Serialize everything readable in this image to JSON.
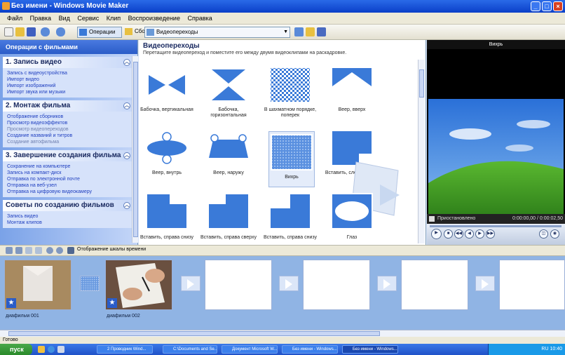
{
  "window": {
    "title": "Без имени - Windows Movie Maker",
    "minimize": "_",
    "maximize": "□",
    "close": "×"
  },
  "menu": {
    "items": [
      "Файл",
      "Правка",
      "Вид",
      "Сервис",
      "Клип",
      "Воспроизведение",
      "Справка"
    ]
  },
  "toolbar": {
    "tasks_label": "Операции",
    "collections_label": "Сборники",
    "collection_value": "Видеопереходы"
  },
  "tasks_panel": {
    "header": "Операции с фильмами",
    "sections": [
      {
        "title": "1. Запись видео",
        "items": [
          "Запись с видеоустройства",
          "Импорт видео",
          "Импорт изображений",
          "Импорт звука или музыки"
        ]
      },
      {
        "title": "2. Монтаж фильма",
        "items": [
          "Отображение сборников",
          "Просмотр видеоэффектов",
          "Просмотр видеопереходов",
          "Создание названий и титров",
          "Создание автофильма"
        ]
      },
      {
        "title": "3. Завершение создания фильма",
        "items": [
          "Сохранение на компьютере",
          "Запись на компакт-диск",
          "Отправка по электронной почте",
          "Отправка на веб-узел",
          "Отправка на цифровую видеокамеру"
        ]
      },
      {
        "title": "Советы по созданию фильмов",
        "items": [
          "Запись видео",
          "Монтаж клипов"
        ]
      }
    ]
  },
  "content": {
    "title": "Видеопереходы",
    "description": "Перетащите видеопереход и поместите его между двумя видеоклипами на раскадровке.",
    "transitions": [
      {
        "label": "Бабочка, вертикальная"
      },
      {
        "label": "Бабочка, горизонтальная"
      },
      {
        "label": "В шахматном порядке, поперек"
      },
      {
        "label": "Веер, вверх"
      },
      {
        "label": "Веер, внутрь"
      },
      {
        "label": "Веер, наружу"
      },
      {
        "label": "Вихрь"
      },
      {
        "label": "Вставить, слева сверху"
      },
      {
        "label": "Вставить, справа снизу"
      },
      {
        "label": "Вставить, справа сверху"
      },
      {
        "label": "Вставить, справа снизу"
      },
      {
        "label": "Глаз"
      }
    ]
  },
  "preview": {
    "title": "Вихрь",
    "status": "Приостановлено",
    "time": "0:00:00,00 / 0:00:02,50",
    "controls": [
      "play",
      "stop",
      "back",
      "prev",
      "next",
      "forward"
    ]
  },
  "timeline": {
    "toggle_label": "Отображение шкалы времени"
  },
  "storyboard": {
    "clips": [
      {
        "label": "диафильм 001"
      },
      {
        "label": "диафильм 002"
      }
    ]
  },
  "status": {
    "text": "Готово"
  },
  "taskbar": {
    "start": "пуск",
    "items": [
      "2 Проводник Wind...",
      "C:\\Documents and Se...",
      "Документ Microsoft W...",
      "Без имени - Windows..."
    ],
    "clock": "RU  10:40"
  },
  "colors": {
    "accent": "#2a5cc8",
    "transition_blue": "#3a7ad8"
  }
}
